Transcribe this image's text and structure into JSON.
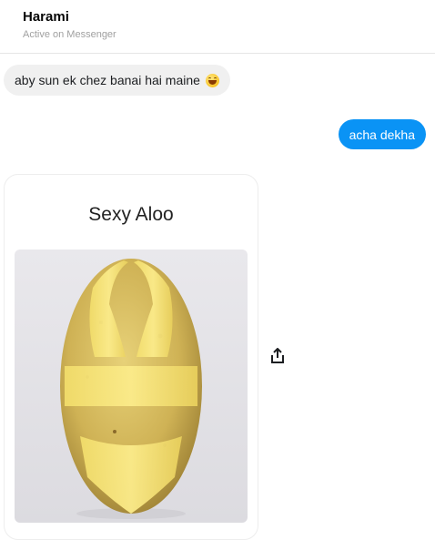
{
  "header": {
    "contact_name": "Harami",
    "status": "Active on Messenger"
  },
  "messages": [
    {
      "direction": "incoming",
      "text": "aby sun ek chez banai hai maine",
      "emoji": "smiling-face-emoji"
    },
    {
      "direction": "outgoing",
      "text": "acha dekha"
    }
  ],
  "shared_image": {
    "title": "Sexy Aloo",
    "subject": "potato-in-bikini-photo"
  },
  "actions": {
    "share_icon": "share-icon"
  },
  "colors": {
    "outgoing_bubble": "#0a93f5",
    "incoming_bubble": "#f0f0f0",
    "background": "#ffffff"
  }
}
